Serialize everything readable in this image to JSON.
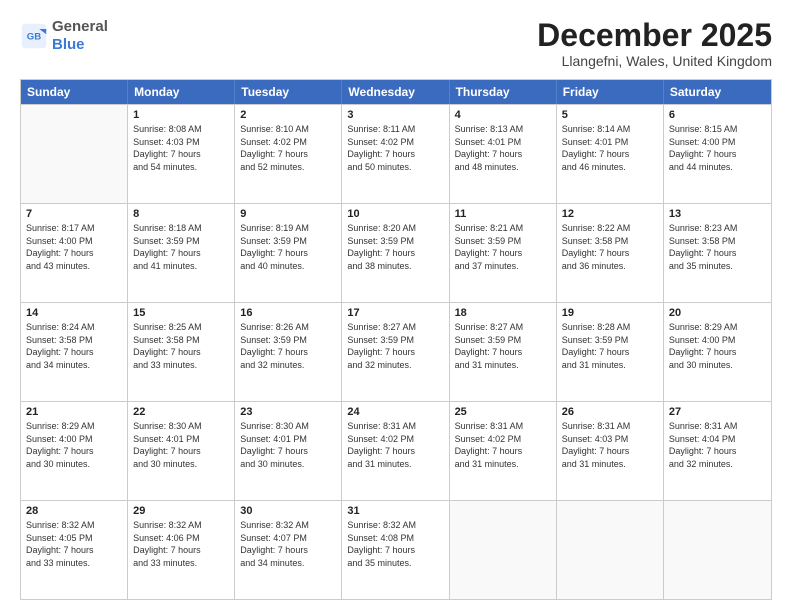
{
  "logo": {
    "general": "General",
    "blue": "Blue"
  },
  "header": {
    "month": "December 2025",
    "location": "Llangefni, Wales, United Kingdom"
  },
  "weekdays": [
    "Sunday",
    "Monday",
    "Tuesday",
    "Wednesday",
    "Thursday",
    "Friday",
    "Saturday"
  ],
  "weeks": [
    [
      {
        "day": "",
        "empty": true
      },
      {
        "day": "1",
        "sunrise": "Sunrise: 8:08 AM",
        "sunset": "Sunset: 4:03 PM",
        "daylight": "Daylight: 7 hours",
        "minutes": "and 54 minutes."
      },
      {
        "day": "2",
        "sunrise": "Sunrise: 8:10 AM",
        "sunset": "Sunset: 4:02 PM",
        "daylight": "Daylight: 7 hours",
        "minutes": "and 52 minutes."
      },
      {
        "day": "3",
        "sunrise": "Sunrise: 8:11 AM",
        "sunset": "Sunset: 4:02 PM",
        "daylight": "Daylight: 7 hours",
        "minutes": "and 50 minutes."
      },
      {
        "day": "4",
        "sunrise": "Sunrise: 8:13 AM",
        "sunset": "Sunset: 4:01 PM",
        "daylight": "Daylight: 7 hours",
        "minutes": "and 48 minutes."
      },
      {
        "day": "5",
        "sunrise": "Sunrise: 8:14 AM",
        "sunset": "Sunset: 4:01 PM",
        "daylight": "Daylight: 7 hours",
        "minutes": "and 46 minutes."
      },
      {
        "day": "6",
        "sunrise": "Sunrise: 8:15 AM",
        "sunset": "Sunset: 4:00 PM",
        "daylight": "Daylight: 7 hours",
        "minutes": "and 44 minutes."
      }
    ],
    [
      {
        "day": "7",
        "sunrise": "Sunrise: 8:17 AM",
        "sunset": "Sunset: 4:00 PM",
        "daylight": "Daylight: 7 hours",
        "minutes": "and 43 minutes."
      },
      {
        "day": "8",
        "sunrise": "Sunrise: 8:18 AM",
        "sunset": "Sunset: 3:59 PM",
        "daylight": "Daylight: 7 hours",
        "minutes": "and 41 minutes."
      },
      {
        "day": "9",
        "sunrise": "Sunrise: 8:19 AM",
        "sunset": "Sunset: 3:59 PM",
        "daylight": "Daylight: 7 hours",
        "minutes": "and 40 minutes."
      },
      {
        "day": "10",
        "sunrise": "Sunrise: 8:20 AM",
        "sunset": "Sunset: 3:59 PM",
        "daylight": "Daylight: 7 hours",
        "minutes": "and 38 minutes."
      },
      {
        "day": "11",
        "sunrise": "Sunrise: 8:21 AM",
        "sunset": "Sunset: 3:59 PM",
        "daylight": "Daylight: 7 hours",
        "minutes": "and 37 minutes."
      },
      {
        "day": "12",
        "sunrise": "Sunrise: 8:22 AM",
        "sunset": "Sunset: 3:58 PM",
        "daylight": "Daylight: 7 hours",
        "minutes": "and 36 minutes."
      },
      {
        "day": "13",
        "sunrise": "Sunrise: 8:23 AM",
        "sunset": "Sunset: 3:58 PM",
        "daylight": "Daylight: 7 hours",
        "minutes": "and 35 minutes."
      }
    ],
    [
      {
        "day": "14",
        "sunrise": "Sunrise: 8:24 AM",
        "sunset": "Sunset: 3:58 PM",
        "daylight": "Daylight: 7 hours",
        "minutes": "and 34 minutes."
      },
      {
        "day": "15",
        "sunrise": "Sunrise: 8:25 AM",
        "sunset": "Sunset: 3:58 PM",
        "daylight": "Daylight: 7 hours",
        "minutes": "and 33 minutes."
      },
      {
        "day": "16",
        "sunrise": "Sunrise: 8:26 AM",
        "sunset": "Sunset: 3:59 PM",
        "daylight": "Daylight: 7 hours",
        "minutes": "and 32 minutes."
      },
      {
        "day": "17",
        "sunrise": "Sunrise: 8:27 AM",
        "sunset": "Sunset: 3:59 PM",
        "daylight": "Daylight: 7 hours",
        "minutes": "and 32 minutes."
      },
      {
        "day": "18",
        "sunrise": "Sunrise: 8:27 AM",
        "sunset": "Sunset: 3:59 PM",
        "daylight": "Daylight: 7 hours",
        "minutes": "and 31 minutes."
      },
      {
        "day": "19",
        "sunrise": "Sunrise: 8:28 AM",
        "sunset": "Sunset: 3:59 PM",
        "daylight": "Daylight: 7 hours",
        "minutes": "and 31 minutes."
      },
      {
        "day": "20",
        "sunrise": "Sunrise: 8:29 AM",
        "sunset": "Sunset: 4:00 PM",
        "daylight": "Daylight: 7 hours",
        "minutes": "and 30 minutes."
      }
    ],
    [
      {
        "day": "21",
        "sunrise": "Sunrise: 8:29 AM",
        "sunset": "Sunset: 4:00 PM",
        "daylight": "Daylight: 7 hours",
        "minutes": "and 30 minutes."
      },
      {
        "day": "22",
        "sunrise": "Sunrise: 8:30 AM",
        "sunset": "Sunset: 4:01 PM",
        "daylight": "Daylight: 7 hours",
        "minutes": "and 30 minutes."
      },
      {
        "day": "23",
        "sunrise": "Sunrise: 8:30 AM",
        "sunset": "Sunset: 4:01 PM",
        "daylight": "Daylight: 7 hours",
        "minutes": "and 30 minutes."
      },
      {
        "day": "24",
        "sunrise": "Sunrise: 8:31 AM",
        "sunset": "Sunset: 4:02 PM",
        "daylight": "Daylight: 7 hours",
        "minutes": "and 31 minutes."
      },
      {
        "day": "25",
        "sunrise": "Sunrise: 8:31 AM",
        "sunset": "Sunset: 4:02 PM",
        "daylight": "Daylight: 7 hours",
        "minutes": "and 31 minutes."
      },
      {
        "day": "26",
        "sunrise": "Sunrise: 8:31 AM",
        "sunset": "Sunset: 4:03 PM",
        "daylight": "Daylight: 7 hours",
        "minutes": "and 31 minutes."
      },
      {
        "day": "27",
        "sunrise": "Sunrise: 8:31 AM",
        "sunset": "Sunset: 4:04 PM",
        "daylight": "Daylight: 7 hours",
        "minutes": "and 32 minutes."
      }
    ],
    [
      {
        "day": "28",
        "sunrise": "Sunrise: 8:32 AM",
        "sunset": "Sunset: 4:05 PM",
        "daylight": "Daylight: 7 hours",
        "minutes": "and 33 minutes."
      },
      {
        "day": "29",
        "sunrise": "Sunrise: 8:32 AM",
        "sunset": "Sunset: 4:06 PM",
        "daylight": "Daylight: 7 hours",
        "minutes": "and 33 minutes."
      },
      {
        "day": "30",
        "sunrise": "Sunrise: 8:32 AM",
        "sunset": "Sunset: 4:07 PM",
        "daylight": "Daylight: 7 hours",
        "minutes": "and 34 minutes."
      },
      {
        "day": "31",
        "sunrise": "Sunrise: 8:32 AM",
        "sunset": "Sunset: 4:08 PM",
        "daylight": "Daylight: 7 hours",
        "minutes": "and 35 minutes."
      },
      {
        "day": "",
        "empty": true
      },
      {
        "day": "",
        "empty": true
      },
      {
        "day": "",
        "empty": true
      }
    ]
  ]
}
